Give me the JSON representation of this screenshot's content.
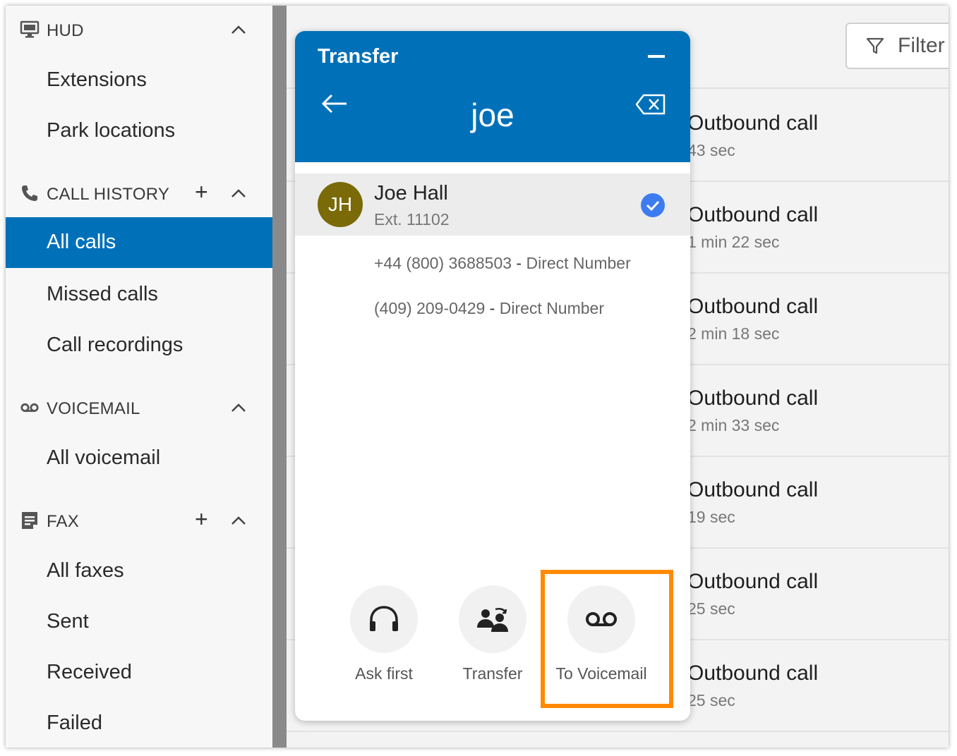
{
  "sidebar": {
    "hud": {
      "label": "HUD",
      "items": [
        "Extensions",
        "Park locations"
      ]
    },
    "call_history": {
      "label": "CALL HISTORY",
      "plus": "+",
      "items": [
        "All calls",
        "Missed calls",
        "Call recordings"
      ],
      "active": "All calls"
    },
    "voicemail": {
      "label": "VOICEMAIL",
      "items": [
        "All voicemail"
      ]
    },
    "fax": {
      "label": "FAX",
      "plus": "+",
      "items": [
        "All faxes",
        "Sent",
        "Received",
        "Failed"
      ]
    }
  },
  "filter": {
    "label": "Filter"
  },
  "call_list": [
    {
      "type": "Outbound call",
      "duration": "43 sec"
    },
    {
      "type": "Outbound call",
      "duration": "1 min 22 sec"
    },
    {
      "type": "Outbound call",
      "duration": "2 min 18 sec"
    },
    {
      "type": "Outbound call",
      "duration": "2 min 33 sec"
    },
    {
      "type": "Outbound call",
      "duration": "19 sec"
    },
    {
      "type": "Outbound call",
      "duration": "25 sec"
    },
    {
      "type": "Outbound call",
      "duration": "25 sec"
    }
  ],
  "transfer": {
    "title": "Transfer",
    "query": "joe",
    "contact": {
      "initials": "JH",
      "name": "Joe Hall",
      "ext": "Ext. 11102",
      "avatar_color": "#7a6a08"
    },
    "numbers": [
      {
        "number": "+44 (800) 3688503",
        "sep": " - ",
        "kind": "Direct Number"
      },
      {
        "number": "(409) 209-0429",
        "sep": " - ",
        "kind": "Direct Number"
      }
    ],
    "actions": [
      "Ask first",
      "Transfer",
      "To Voicemail"
    ]
  },
  "colors": {
    "brand": "#0071b9",
    "highlight": "#ff8a00",
    "check": "#3d7cf0"
  }
}
